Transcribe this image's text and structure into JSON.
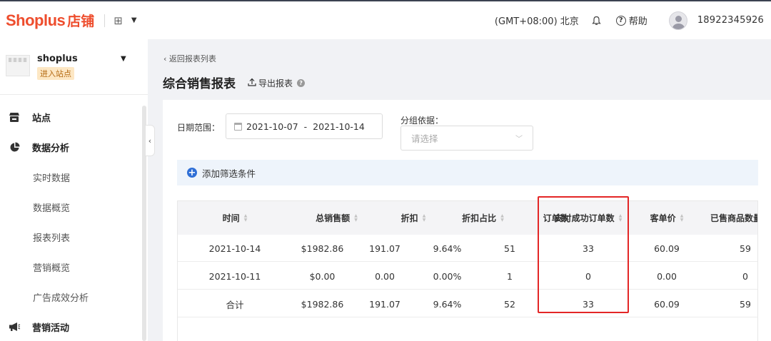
{
  "topbar": {
    "brand": "Shoplus",
    "brand_suffix": "店铺",
    "apps_icon": "grid-icon",
    "timezone": "(GMT+08:00) 北京",
    "help": "帮助",
    "phone": "18922345926"
  },
  "sidebar": {
    "shop_name": "shoplus",
    "enter_site": "进入站点",
    "items": [
      {
        "label": "站点",
        "type": "section",
        "icon": "store-icon"
      },
      {
        "label": "数据分析",
        "type": "section",
        "icon": "pie-chart-icon"
      },
      {
        "label": "实时数据",
        "type": "sub"
      },
      {
        "label": "数据概览",
        "type": "sub"
      },
      {
        "label": "报表列表",
        "type": "sub"
      },
      {
        "label": "营销概览",
        "type": "sub"
      },
      {
        "label": "广告成效分析",
        "type": "sub"
      },
      {
        "label": "营销活动",
        "type": "section",
        "icon": "megaphone-icon"
      }
    ]
  },
  "main": {
    "back_link": "返回报表列表",
    "title": "综合销售报表",
    "export": "导出报表",
    "filters": {
      "date_label": "日期范围：",
      "date_start": "2021-10-07",
      "date_sep": "-",
      "date_end": "2021-10-14",
      "group_label": "分组依据：",
      "group_placeholder": "请选择"
    },
    "add_filter": "添加筛选条件",
    "table": {
      "columns": [
        "时间",
        "总销售额",
        "折扣",
        "折扣占比",
        "订单数",
        "支付成功订单数",
        "客单价",
        "已售商品数量"
      ],
      "rows": [
        [
          "2021-10-14",
          "$1982.86",
          "191.07",
          "9.64%",
          "51",
          "33",
          "60.09",
          "59"
        ],
        [
          "2021-10-11",
          "$0.00",
          "0.00",
          "0.00%",
          "1",
          "0",
          "0.00",
          "0"
        ],
        [
          "合计",
          "$1982.86",
          "191.07",
          "9.64%",
          "52",
          "33",
          "60.09",
          "59"
        ]
      ]
    }
  },
  "colors": {
    "brand": "#ee4d2d",
    "highlight": "#e32626",
    "link_blue": "#2f6fd6"
  }
}
